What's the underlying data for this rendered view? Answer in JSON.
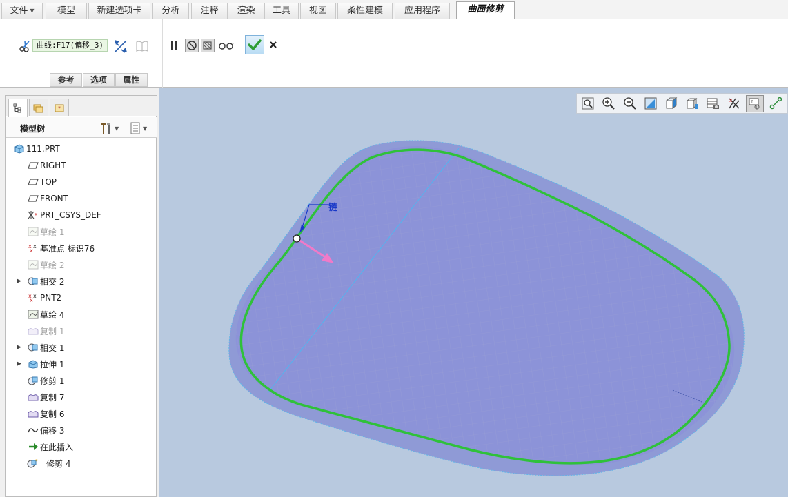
{
  "menu": {
    "tabs": [
      {
        "label": "文件",
        "dropdown": true
      },
      {
        "label": "模型"
      },
      {
        "label": "新建选项卡"
      },
      {
        "label": "分析"
      },
      {
        "label": "注释"
      },
      {
        "label": "渲染"
      },
      {
        "label": "工具"
      },
      {
        "label": "视图"
      },
      {
        "label": "柔性建模"
      },
      {
        "label": "应用程序"
      },
      {
        "label": "曲面修剪",
        "active": true
      }
    ]
  },
  "ribbon": {
    "trim_object": "曲线:F17(偏移_3)",
    "subtabs": [
      "参考",
      "选项",
      "属性"
    ]
  },
  "model_tree": {
    "title": "模型树",
    "items": [
      {
        "label": "111.PRT",
        "icon": "part-icon",
        "expand": false,
        "dim": false
      },
      {
        "label": "RIGHT",
        "icon": "datum-plane-icon",
        "expand": false,
        "dim": false
      },
      {
        "label": "TOP",
        "icon": "datum-plane-icon",
        "expand": false,
        "dim": false
      },
      {
        "label": "FRONT",
        "icon": "datum-plane-icon",
        "expand": false,
        "dim": false
      },
      {
        "label": "PRT_CSYS_DEF",
        "icon": "coordinate-system-icon",
        "expand": false,
        "dim": false
      },
      {
        "label": "草绘 1",
        "icon": "sketch-icon",
        "expand": false,
        "dim": true
      },
      {
        "label": "基准点 标识76",
        "icon": "datum-point-icon",
        "expand": false,
        "dim": false
      },
      {
        "label": "草绘 2",
        "icon": "sketch-icon",
        "expand": false,
        "dim": true
      },
      {
        "label": "相交 2",
        "icon": "intersect-icon",
        "expand": true,
        "dim": false
      },
      {
        "label": "PNT2",
        "icon": "datum-point-icon",
        "expand": false,
        "dim": false
      },
      {
        "label": "草绘 4",
        "icon": "sketch-icon",
        "expand": false,
        "dim": false
      },
      {
        "label": "复制 1",
        "icon": "copy-icon",
        "expand": false,
        "dim": true
      },
      {
        "label": "相交 1",
        "icon": "intersect-icon",
        "expand": true,
        "dim": false
      },
      {
        "label": "拉伸 1",
        "icon": "extrude-icon",
        "expand": true,
        "dim": false
      },
      {
        "label": "修剪 1",
        "icon": "trim-icon",
        "expand": false,
        "dim": false
      },
      {
        "label": "复制 7",
        "icon": "copy-icon",
        "expand": false,
        "dim": false
      },
      {
        "label": "复制 6",
        "icon": "copy-icon",
        "expand": false,
        "dim": false
      },
      {
        "label": "偏移 3",
        "icon": "offset-icon",
        "expand": false,
        "dim": false
      },
      {
        "label": "在此插入",
        "icon": "insert-here-icon",
        "expand": false,
        "dim": false
      },
      {
        "label": "修剪 4",
        "icon": "trim-new-icon",
        "expand": false,
        "dim": false
      }
    ]
  },
  "viewport": {
    "chain_label": "链"
  },
  "colors": {
    "viewport_bg": "#b8c9df",
    "surface_fill": "#8d97d6",
    "trim_curve": "#2fc13a",
    "direction_arrow": "#f07ac8",
    "chain_color": "#1838c8",
    "confirm_check": "#2f9e36"
  }
}
